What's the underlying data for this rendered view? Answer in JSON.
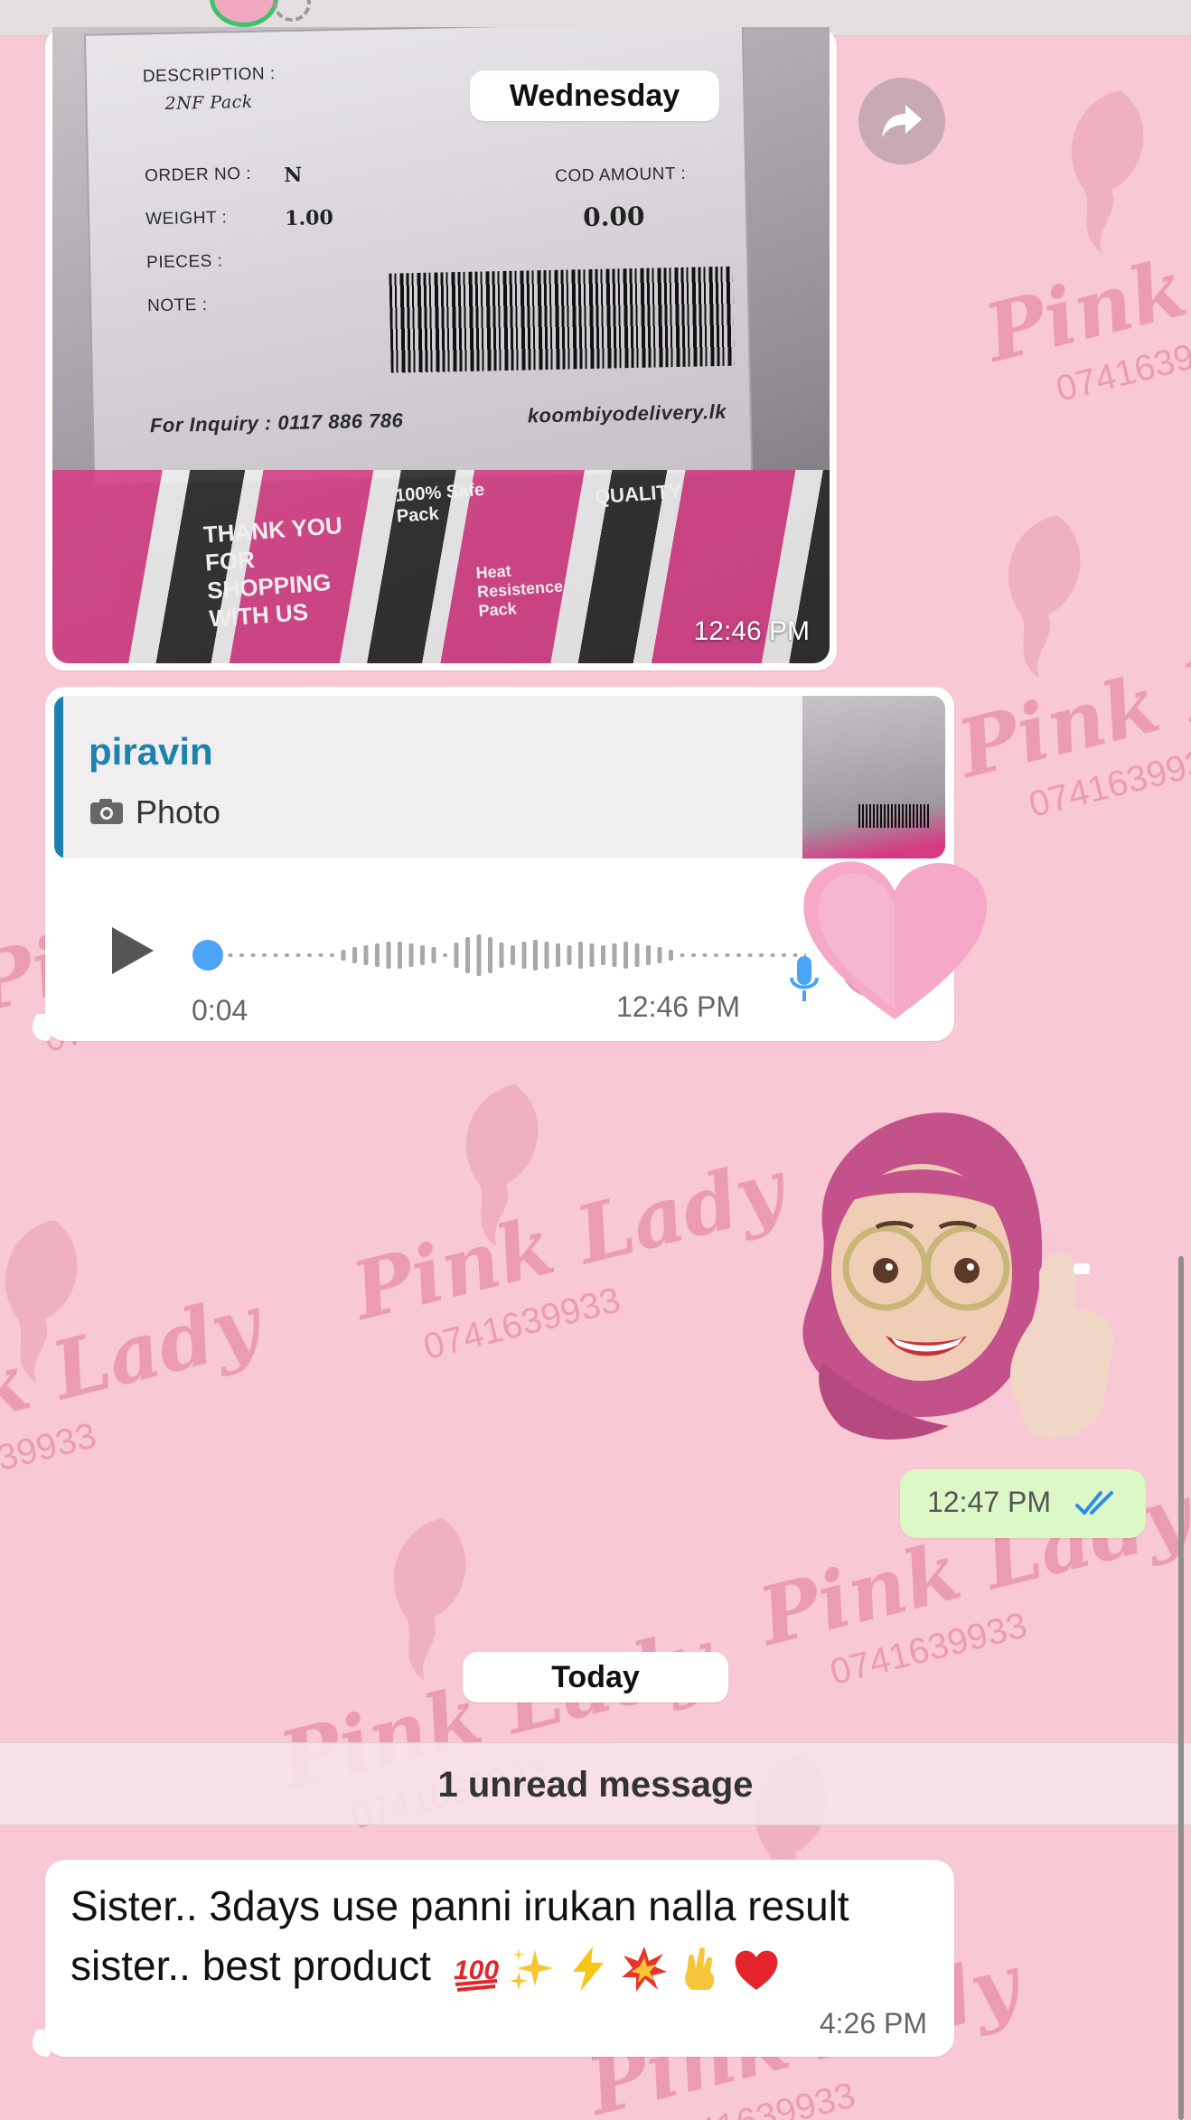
{
  "wallpaper": {
    "brand": "Pink Lady",
    "phone": "0741639933"
  },
  "dates": {
    "wednesday": "Wednesday",
    "today": "Today"
  },
  "image_message": {
    "time": "12:46 PM",
    "label": {
      "description_label": "DESCRIPTION :",
      "description_value": "2NF Pack",
      "order_label": "ORDER NO :",
      "order_value": "N",
      "weight_label": "WEIGHT :",
      "weight_value": "1.00",
      "pieces_label": "PIECES :",
      "note_label": "NOTE :",
      "cod_label": "COD AMOUNT :",
      "cod_value": "0.00",
      "inquiry": "For Inquiry : 0117 886 786",
      "website": "koombiyodelivery.lk"
    },
    "packaging": {
      "thank_you": "THANK YOU FOR SHOPPING WITH US",
      "safe_pack": "100% Safe Pack",
      "quality": "QUALITY",
      "heat": "Heat Resistence Pack"
    }
  },
  "voice_message": {
    "reply_to_name": "piravin",
    "reply_to_type": "Photo",
    "duration": "0:04",
    "time": "12:46 PM",
    "progress": 0.0
  },
  "outgoing_sticker_message": {
    "time": "12:47 PM",
    "status": "read"
  },
  "unread_banner": "1 unread message",
  "text_message": {
    "text": "Sister.. 3days use panni irukan nalla result sister.. best product",
    "emojis": [
      "hundred-points",
      "sparkles",
      "high-voltage",
      "collision",
      "victory-hand",
      "red-heart"
    ],
    "time": "4:26 PM"
  },
  "colors": {
    "wallpaper": "#f8c8d4",
    "reply_accent": "#1d82b0",
    "outgoing_bubble": "#dcf8c6",
    "read_ticks": "#2a8cf0",
    "voice_dot": "#4aa3f5"
  }
}
